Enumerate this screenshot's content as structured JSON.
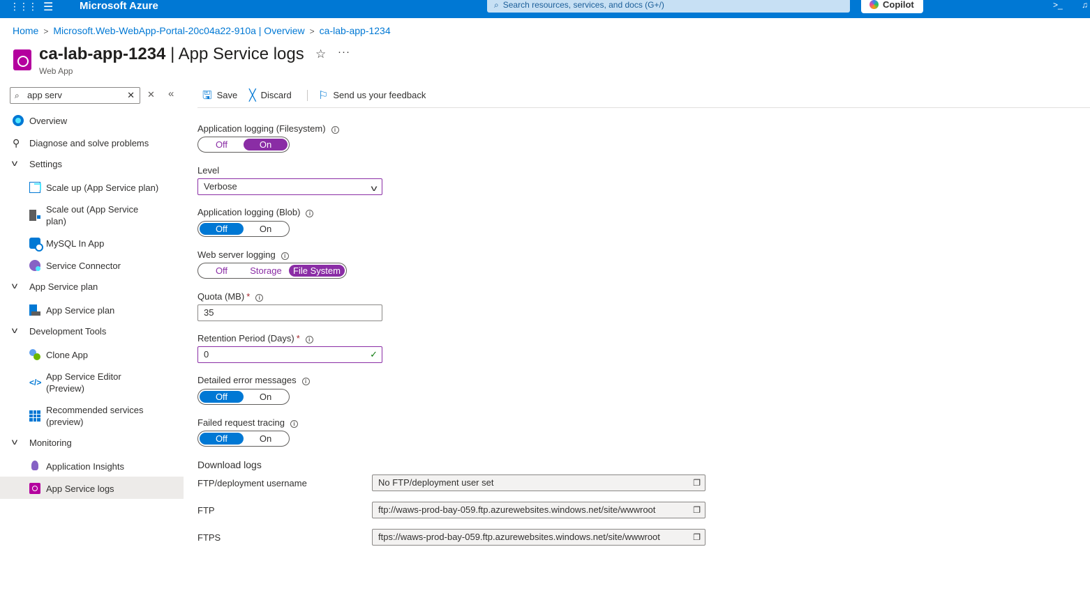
{
  "topbar": {
    "brand": "Microsoft Azure",
    "search_placeholder": "Search resources, services, and docs (G+/)",
    "copilot_label": "Copilot",
    "waffle_icon": "waffle-icon",
    "menu_icon": "hamburger-icon",
    "accent_color": "#0078d4"
  },
  "breadcrumb": {
    "items": [
      "Home",
      "Microsoft.Web-WebApp-Portal-20c04a22-910a | Overview",
      "ca-lab-app-1234"
    ]
  },
  "header": {
    "resource_name": "ca-lab-app-1234",
    "page_name": "| App Service logs",
    "subtitle": "Web App"
  },
  "sidebar": {
    "search_value": "app serv",
    "items": [
      {
        "label": "Overview"
      },
      {
        "label": "Diagnose and solve problems"
      },
      {
        "label": "Settings"
      },
      {
        "label": "Scale up (App Service plan)"
      },
      {
        "label": "Scale out (App Service plan)"
      },
      {
        "label": "MySQL In App"
      },
      {
        "label": "Service Connector"
      },
      {
        "label": "App Service plan"
      },
      {
        "label": "App Service plan"
      },
      {
        "label": "Development Tools"
      },
      {
        "label": "Clone App"
      },
      {
        "label": "App Service Editor (Preview)"
      },
      {
        "label": "Recommended services (preview)"
      },
      {
        "label": "Monitoring"
      },
      {
        "label": "Application Insights"
      },
      {
        "label": "App Service logs"
      }
    ],
    "active_item": "App Service logs"
  },
  "toolbar": {
    "save_label": "Save",
    "discard_label": "Discard",
    "feedback_label": "Send us your feedback"
  },
  "form": {
    "app_logging_fs": {
      "label": "Application logging (Filesystem)",
      "off": "Off",
      "on": "On",
      "selected": "On"
    },
    "level": {
      "label": "Level",
      "value": "Verbose"
    },
    "app_logging_blob": {
      "label": "Application logging (Blob)",
      "off": "Off",
      "on": "On",
      "selected": "Off"
    },
    "web_server_logging": {
      "label": "Web server logging",
      "off": "Off",
      "storage": "Storage",
      "filesystem": "File System",
      "selected": "File System"
    },
    "quota": {
      "label": "Quota (MB)",
      "required": "*",
      "value": "35"
    },
    "retention": {
      "label": "Retention Period (Days)",
      "required": "*",
      "value": "0"
    },
    "detailed_errors": {
      "label": "Detailed error messages",
      "off": "Off",
      "on": "On",
      "selected": "Off"
    },
    "failed_request": {
      "label": "Failed request tracing",
      "off": "Off",
      "on": "On",
      "selected": "Off"
    }
  },
  "download_logs": {
    "heading": "Download logs",
    "ftp_user_label": "FTP/deployment username",
    "ftp_user_value": "No FTP/deployment user set",
    "ftp_label": "FTP",
    "ftp_value": "ftp://waws-prod-bay-059.ftp.azurewebsites.windows.net/site/wwwroot",
    "ftps_label": "FTPS",
    "ftps_value": "ftps://waws-prod-bay-059.ftp.azurewebsites.windows.net/site/wwwroot"
  },
  "colors": {
    "toggle_selected_purple": "#8a2da5",
    "toggle_selected_blue": "#0078d4",
    "required_star": "#a4262c",
    "valid_check": "#107c10"
  }
}
